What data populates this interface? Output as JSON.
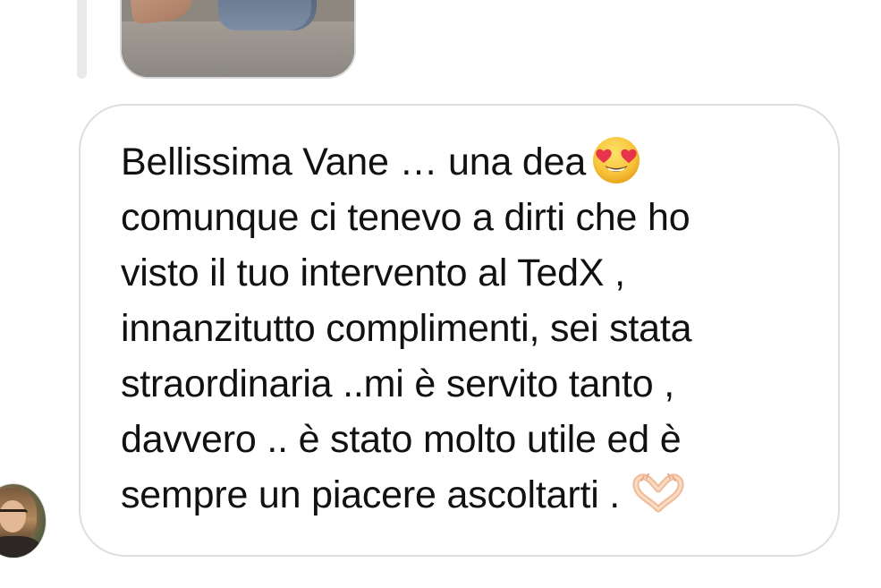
{
  "thread": {
    "reply_indicator": "reply-bar",
    "shared_media": {
      "kind": "photo",
      "description_icon": "photo-thumbnail"
    }
  },
  "message": {
    "sender_avatar_icon": "user-avatar",
    "lines": [
      "Bellissima Vane … una dea",
      "comunque ci tenevo a dirti che ho",
      "visto il tuo intervento al TedX ,",
      "innanzitutto complimenti, sei stata",
      "straordinaria ..mi è servito tanto ,",
      "davvero .. è stato molto utile ed è",
      "sempre un piacere ascoltarti ."
    ],
    "emojis": {
      "line_1": "heart-eyes-emoji",
      "line_7": "heart-hands-emoji"
    }
  },
  "colors": {
    "bubble_border": "#dedede",
    "text": "#111111",
    "reply_bar": "#e9e9eb",
    "emoji_face": "#f7c33a",
    "emoji_heart": "#e8344a",
    "hands_skin": "#f7d7bd"
  }
}
